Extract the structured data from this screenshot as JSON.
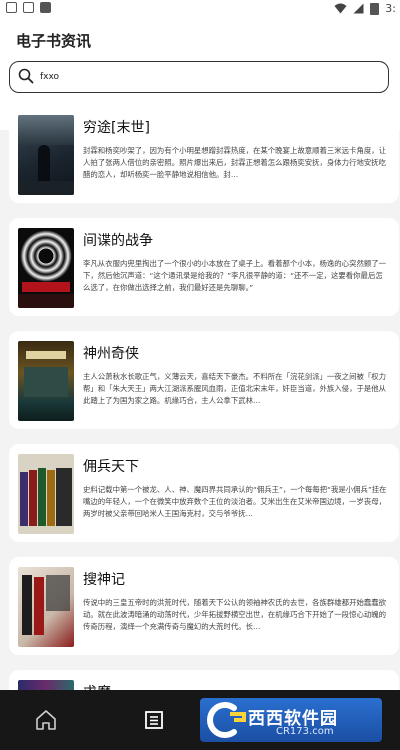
{
  "status_bar": {
    "time": "3:"
  },
  "header": {
    "title": "电子书资讯"
  },
  "search": {
    "value": "fxxo",
    "placeholder": ""
  },
  "books": [
    {
      "title": "穷途[末世]",
      "description": "封霖和杨奕吵架了，因为有个小明星想蹭封霖热度，在某个晚宴上故意顺着三米远卡角度，让人拍了张两人借位的亲密照。照片爆出来后，封霖正想着怎么跟杨奕安抚，身体力行地安抚吃醋的恋人，却听杨奕一脸平静地说相信他。封…"
    },
    {
      "title": "间谍的战争",
      "description": "李凡从衣服内兜里掏出了一个很小的小本放在了桌子上。看着那个小本，杨逸的心突然颤了一下，然后他沉声道：“这个通讯录是给我的？”李凡很平静的道：“还不一定，这要看你最后怎么选了，在你做出选择之前，我们最好还是先聊聊。”"
    },
    {
      "title": "神州奇侠",
      "description": "主人公萧秋水长歌正气，义薄云天，喜结天下豪杰。不料所在「浣花剑派」一夜之间被「权力帮」和「朱大天王」两大江湖派系腥风血雨，正值北宋末年，奸臣当道，外族入侵，于是他从此踏上了为国为家之路。机缘巧合，主人公拿下武林…"
    },
    {
      "title": "佣兵天下",
      "description": "史料记载中第一个被龙、人、神、魔四界共同承认的“佣兵王”，一个每每把“我是小佣兵”挂在嘴边的年轻人，一个在微笑中放弃数个王位的淡泊者。艾米出生在艾米帝国边境，一岁丧母，两岁时被父亲带回哈米人王国海克村，交与爷爷抚…"
    },
    {
      "title": "搜神记",
      "description": "传说中的三皇五帝时的洪荒时代，随着天下公认的领袖神农氏的去世，各族群雄都开始蠢蠢欲动。就在此波涛暗涌的动荡时代，少年拓拔野横空出世，在机缘巧合下开始了一段惊心动魄的传奇历程，演绎一个充满传奇与魔幻的大荒时代。长…"
    },
    {
      "title": "求魔",
      "description": ""
    }
  ],
  "watermark": {
    "site": "西西软件园",
    "url": "CR173.com"
  },
  "colors": {
    "background": "#f3f3f3",
    "card": "#ffffff",
    "nav": "#171717"
  }
}
